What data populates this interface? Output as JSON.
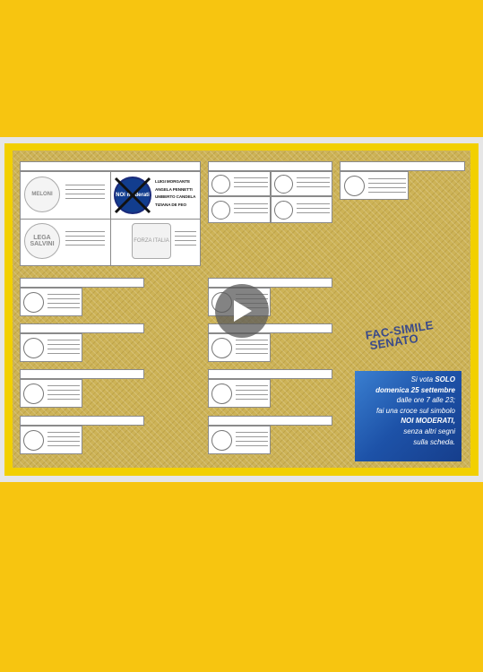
{
  "ballot": {
    "coalition": {
      "candidates": [
        "LUIGI MORGANTE",
        "ANGELA PENNETTI",
        "UMBERTO CANDELA",
        "TIZIANA DE FEO"
      ],
      "logos": {
        "fdi": "MELONI",
        "lega": "LEGA SALVINI",
        "noi": "NOI moderati",
        "fi": "FORZA ITALIA"
      }
    },
    "fac_simile": [
      "FAC-SIMILE",
      "SENATO"
    ],
    "info": {
      "l1a": "Si vota ",
      "l1b": "SOLO",
      "l2": "domenica 25 settembre",
      "l3": "dalle ore 7 alle 23;",
      "l4": "fai una croce sul simbolo",
      "l5": "NOI MODERATI,",
      "l6": "senza altri segni",
      "l7": "sulla scheda."
    }
  },
  "player": {
    "play_icon": "play-icon"
  },
  "colors": {
    "background": "#f7c510",
    "ballot": "#cdb357",
    "info_box": "#1d52a8",
    "fac_text": "#3a4a8a"
  }
}
